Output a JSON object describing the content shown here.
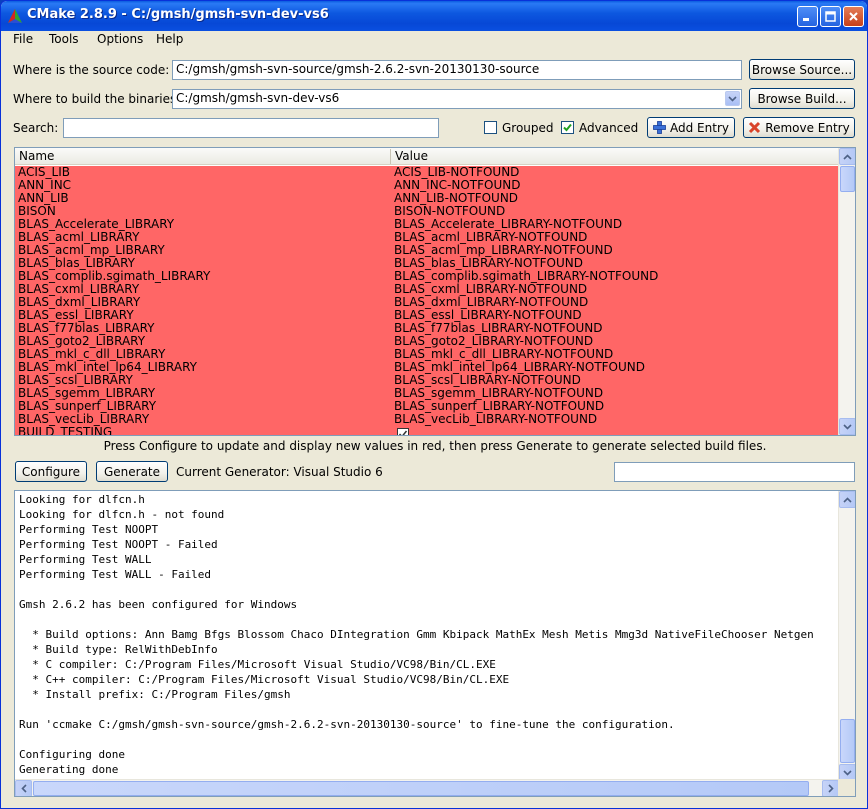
{
  "window": {
    "title": "CMake 2.8.9 - C:/gmsh/gmsh-svn-dev-vs6",
    "title_bar_color": "#0a4fe0"
  },
  "menu": [
    "File",
    "Tools",
    "Options",
    "Help"
  ],
  "source": {
    "label": "Where is the source code:",
    "value": "C:/gmsh/gmsh-svn-source/gmsh-2.6.2-svn-20130130-source",
    "browse_label": "Browse Source..."
  },
  "build": {
    "label": "Where to build the binaries:",
    "value": "C:/gmsh/gmsh-svn-dev-vs6",
    "browse_label": "Browse Build..."
  },
  "search": {
    "label": "Search:",
    "value": ""
  },
  "options": {
    "grouped_label": "Grouped",
    "grouped_checked": false,
    "advanced_label": "Advanced",
    "advanced_checked": true,
    "add_entry_label": "Add Entry",
    "remove_entry_label": "Remove Entry"
  },
  "table": {
    "col_name": "Name",
    "col_value": "Value",
    "row_color": "#ff6666",
    "rows": [
      {
        "name": "ACIS_LIB",
        "value": "ACIS_LIB-NOTFOUND"
      },
      {
        "name": "ANN_INC",
        "value": "ANN_INC-NOTFOUND"
      },
      {
        "name": "ANN_LIB",
        "value": "ANN_LIB-NOTFOUND"
      },
      {
        "name": "BISON",
        "value": "BISON-NOTFOUND"
      },
      {
        "name": "BLAS_Accelerate_LIBRARY",
        "value": "BLAS_Accelerate_LIBRARY-NOTFOUND"
      },
      {
        "name": "BLAS_acml_LIBRARY",
        "value": "BLAS_acml_LIBRARY-NOTFOUND"
      },
      {
        "name": "BLAS_acml_mp_LIBRARY",
        "value": "BLAS_acml_mp_LIBRARY-NOTFOUND"
      },
      {
        "name": "BLAS_blas_LIBRARY",
        "value": "BLAS_blas_LIBRARY-NOTFOUND"
      },
      {
        "name": "BLAS_complib.sgimath_LIBRARY",
        "value": "BLAS_complib.sgimath_LIBRARY-NOTFOUND"
      },
      {
        "name": "BLAS_cxml_LIBRARY",
        "value": "BLAS_cxml_LIBRARY-NOTFOUND"
      },
      {
        "name": "BLAS_dxml_LIBRARY",
        "value": "BLAS_dxml_LIBRARY-NOTFOUND"
      },
      {
        "name": "BLAS_essl_LIBRARY",
        "value": "BLAS_essl_LIBRARY-NOTFOUND"
      },
      {
        "name": "BLAS_f77blas_LIBRARY",
        "value": "BLAS_f77blas_LIBRARY-NOTFOUND"
      },
      {
        "name": "BLAS_goto2_LIBRARY",
        "value": "BLAS_goto2_LIBRARY-NOTFOUND"
      },
      {
        "name": "BLAS_mkl_c_dll_LIBRARY",
        "value": "BLAS_mkl_c_dll_LIBRARY-NOTFOUND"
      },
      {
        "name": "BLAS_mkl_intel_lp64_LIBRARY",
        "value": "BLAS_mkl_intel_lp64_LIBRARY-NOTFOUND"
      },
      {
        "name": "BLAS_scsl_LIBRARY",
        "value": "BLAS_scsl_LIBRARY-NOTFOUND"
      },
      {
        "name": "BLAS_sgemm_LIBRARY",
        "value": "BLAS_sgemm_LIBRARY-NOTFOUND"
      },
      {
        "name": "BLAS_sunperf_LIBRARY",
        "value": "BLAS_sunperf_LIBRARY-NOTFOUND"
      },
      {
        "name": "BLAS_vecLib_LIBRARY",
        "value": "BLAS_vecLib_LIBRARY-NOTFOUND"
      },
      {
        "name": "BUILD_TESTING",
        "value": "",
        "checkbox": true
      }
    ]
  },
  "hint": "Press Configure to update and display new values in red, then press Generate to generate selected build files.",
  "actions": {
    "configure_label": "Configure",
    "generate_label": "Generate",
    "generator_text": "Current Generator: Visual Studio 6",
    "progress": 0
  },
  "output": {
    "lines": [
      "Looking for dlfcn.h",
      "Looking for dlfcn.h - not found",
      "Performing Test NOOPT",
      "Performing Test NOOPT - Failed",
      "Performing Test WALL",
      "Performing Test WALL - Failed",
      "",
      "Gmsh 2.6.2 has been configured for Windows",
      "",
      "  * Build options: Ann Bamg Bfgs Blossom Chaco DIntegration Gmm Kbipack MathEx Mesh Metis Mmg3d NativeFileChooser Netgen",
      "  * Build type: RelWithDebInfo",
      "  * C compiler: C:/Program Files/Microsoft Visual Studio/VC98/Bin/CL.EXE",
      "  * C++ compiler: C:/Program Files/Microsoft Visual Studio/VC98/Bin/CL.EXE",
      "  * Install prefix: C:/Program Files/gmsh",
      "",
      "Run 'ccmake C:/gmsh/gmsh-svn-source/gmsh-2.6.2-svn-20130130-source' to fine-tune the configuration.",
      "",
      "Configuring done",
      "Generating done"
    ]
  }
}
